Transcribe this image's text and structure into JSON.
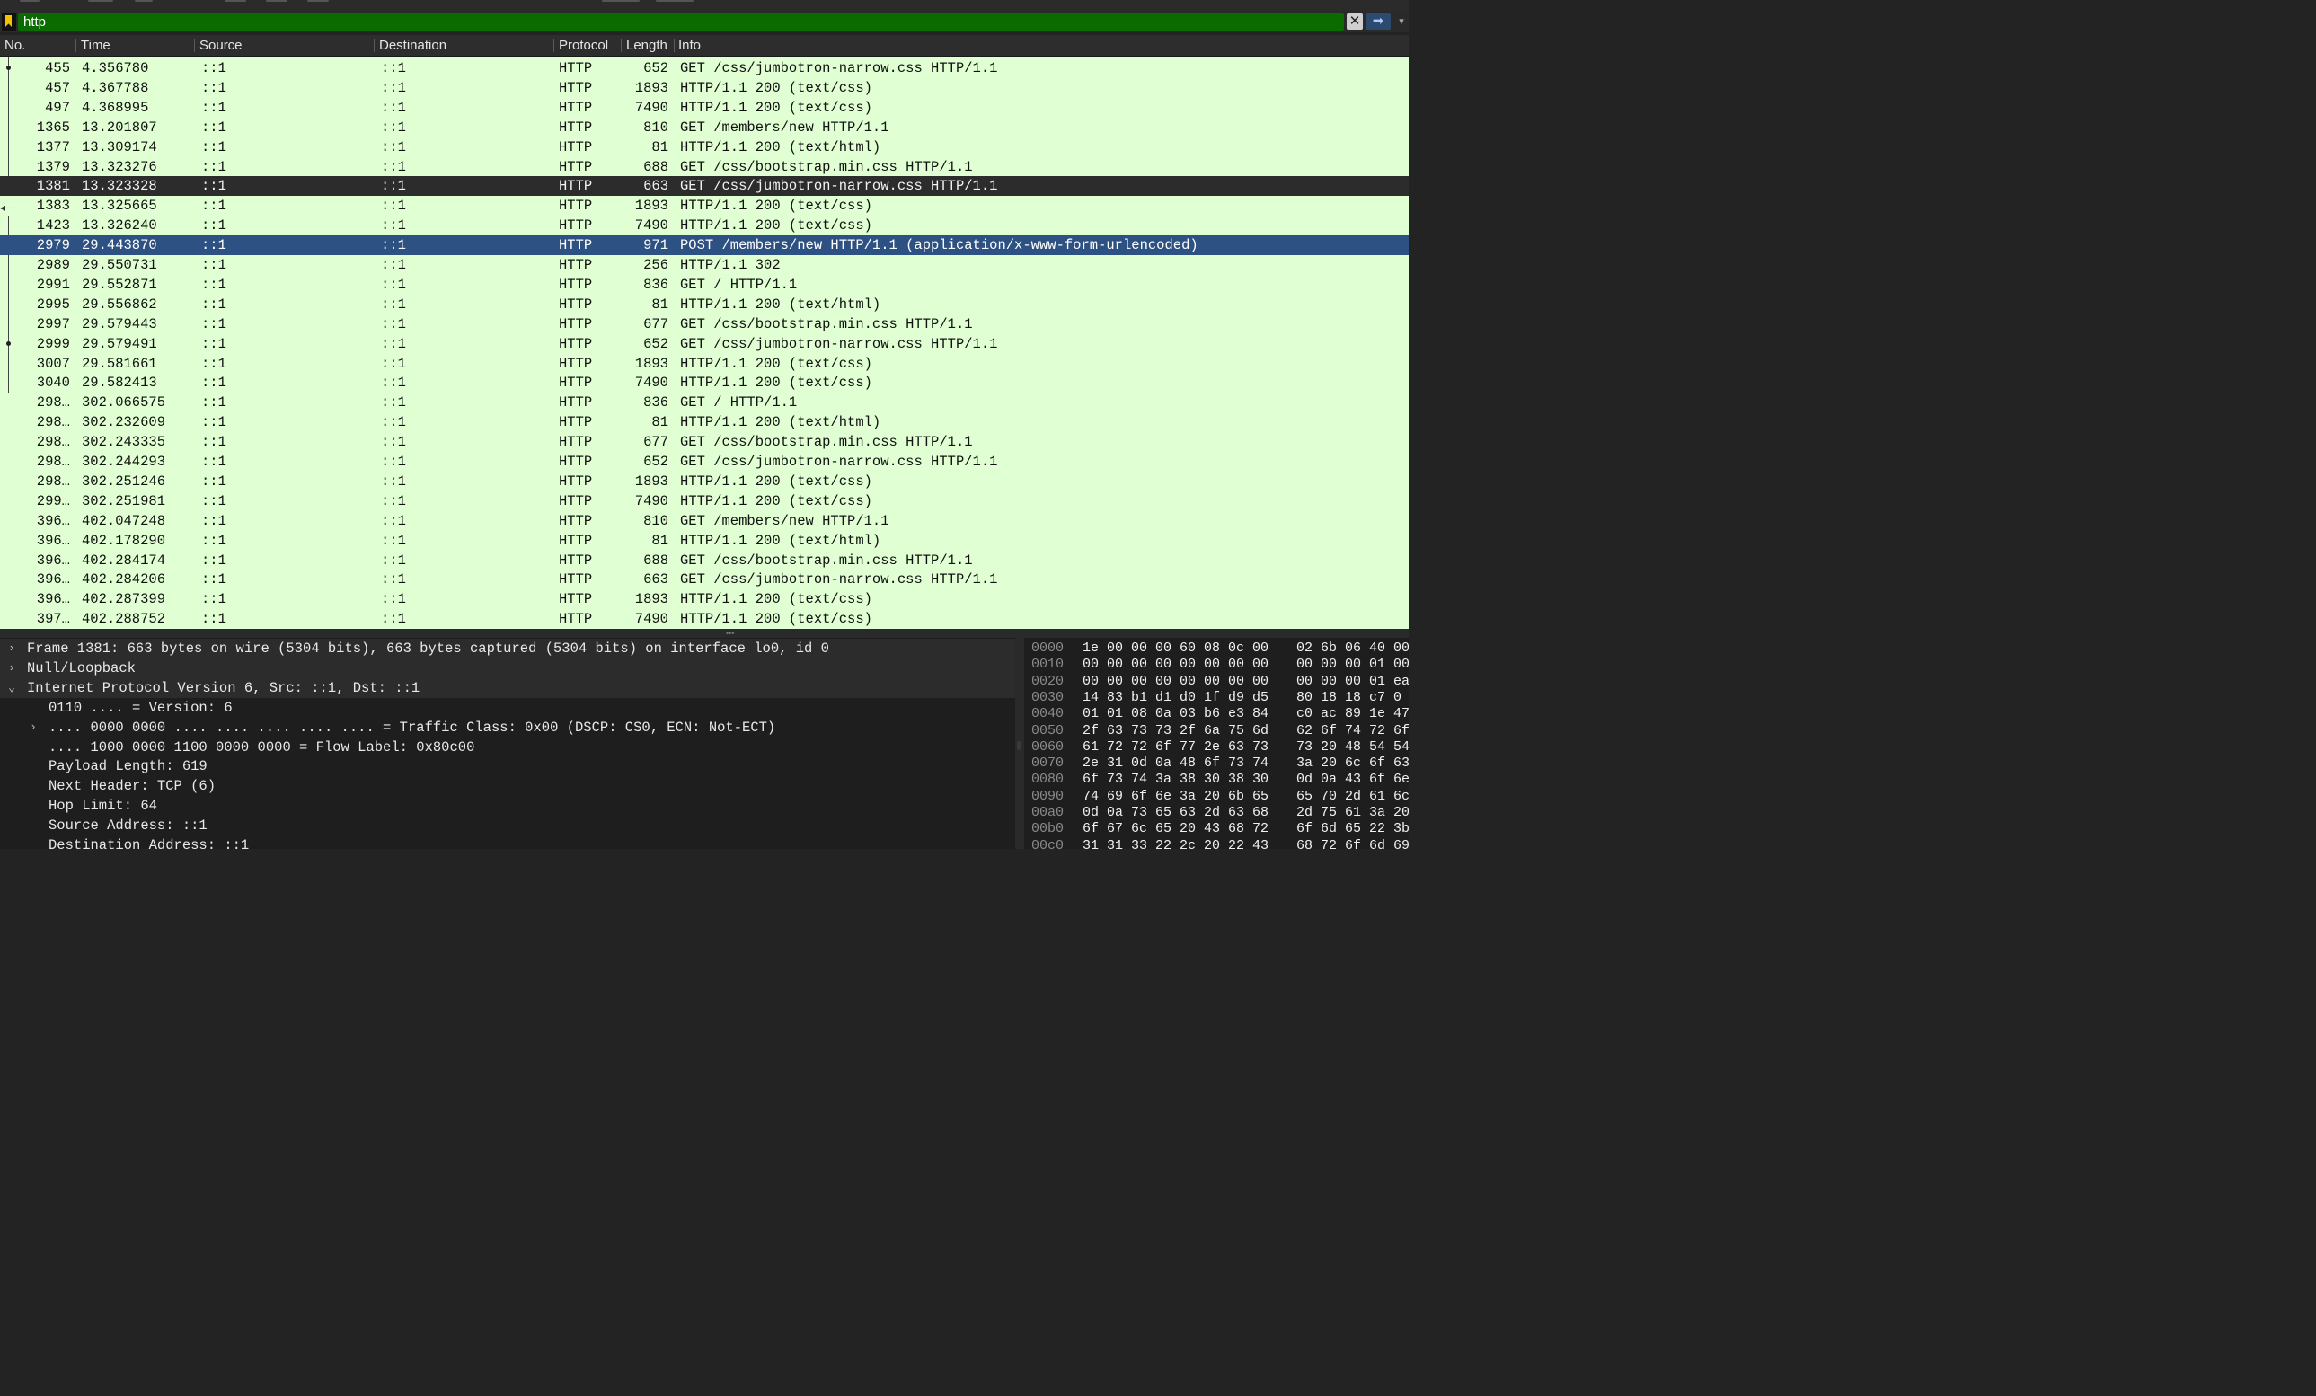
{
  "filter": {
    "value": "http",
    "clear_symbol": "✕",
    "apply_symbol": "➡",
    "dropdown_symbol": "▾"
  },
  "columns": [
    "No.",
    "Time",
    "Source",
    "Destination",
    "Protocol",
    "Length",
    "Info"
  ],
  "packets": [
    {
      "no": "455",
      "time": "4.356780",
      "src": "::1",
      "dst": "::1",
      "proto": "HTTP",
      "len": "652",
      "info": "GET /css/jumbotron-narrow.css HTTP/1.1"
    },
    {
      "no": "457",
      "time": "4.367788",
      "src": "::1",
      "dst": "::1",
      "proto": "HTTP",
      "len": "1893",
      "info": "HTTP/1.1 200   (text/css)"
    },
    {
      "no": "497",
      "time": "4.368995",
      "src": "::1",
      "dst": "::1",
      "proto": "HTTP",
      "len": "7490",
      "info": "HTTP/1.1 200   (text/css)"
    },
    {
      "no": "1365",
      "time": "13.201807",
      "src": "::1",
      "dst": "::1",
      "proto": "HTTP",
      "len": "810",
      "info": "GET /members/new HTTP/1.1"
    },
    {
      "no": "1377",
      "time": "13.309174",
      "src": "::1",
      "dst": "::1",
      "proto": "HTTP",
      "len": "81",
      "info": "HTTP/1.1 200   (text/html)"
    },
    {
      "no": "1379",
      "time": "13.323276",
      "src": "::1",
      "dst": "::1",
      "proto": "HTTP",
      "len": "688",
      "info": "GET /css/bootstrap.min.css HTTP/1.1"
    },
    {
      "no": "1381",
      "time": "13.323328",
      "src": "::1",
      "dst": "::1",
      "proto": "HTTP",
      "len": "663",
      "info": "GET /css/jumbotron-narrow.css HTTP/1.1"
    },
    {
      "no": "1383",
      "time": "13.325665",
      "src": "::1",
      "dst": "::1",
      "proto": "HTTP",
      "len": "1893",
      "info": "HTTP/1.1 200   (text/css)"
    },
    {
      "no": "1423",
      "time": "13.326240",
      "src": "::1",
      "dst": "::1",
      "proto": "HTTP",
      "len": "7490",
      "info": "HTTP/1.1 200   (text/css)"
    },
    {
      "no": "2979",
      "time": "29.443870",
      "src": "::1",
      "dst": "::1",
      "proto": "HTTP",
      "len": "971",
      "info": "POST /members/new HTTP/1.1  (application/x-www-form-urlencoded)"
    },
    {
      "no": "2989",
      "time": "29.550731",
      "src": "::1",
      "dst": "::1",
      "proto": "HTTP",
      "len": "256",
      "info": "HTTP/1.1 302"
    },
    {
      "no": "2991",
      "time": "29.552871",
      "src": "::1",
      "dst": "::1",
      "proto": "HTTP",
      "len": "836",
      "info": "GET / HTTP/1.1"
    },
    {
      "no": "2995",
      "time": "29.556862",
      "src": "::1",
      "dst": "::1",
      "proto": "HTTP",
      "len": "81",
      "info": "HTTP/1.1 200   (text/html)"
    },
    {
      "no": "2997",
      "time": "29.579443",
      "src": "::1",
      "dst": "::1",
      "proto": "HTTP",
      "len": "677",
      "info": "GET /css/bootstrap.min.css HTTP/1.1"
    },
    {
      "no": "2999",
      "time": "29.579491",
      "src": "::1",
      "dst": "::1",
      "proto": "HTTP",
      "len": "652",
      "info": "GET /css/jumbotron-narrow.css HTTP/1.1"
    },
    {
      "no": "3007",
      "time": "29.581661",
      "src": "::1",
      "dst": "::1",
      "proto": "HTTP",
      "len": "1893",
      "info": "HTTP/1.1 200   (text/css)"
    },
    {
      "no": "3040",
      "time": "29.582413",
      "src": "::1",
      "dst": "::1",
      "proto": "HTTP",
      "len": "7490",
      "info": "HTTP/1.1 200   (text/css)"
    },
    {
      "no": "298…",
      "time": "302.066575",
      "src": "::1",
      "dst": "::1",
      "proto": "HTTP",
      "len": "836",
      "info": "GET / HTTP/1.1"
    },
    {
      "no": "298…",
      "time": "302.232609",
      "src": "::1",
      "dst": "::1",
      "proto": "HTTP",
      "len": "81",
      "info": "HTTP/1.1 200   (text/html)"
    },
    {
      "no": "298…",
      "time": "302.243335",
      "src": "::1",
      "dst": "::1",
      "proto": "HTTP",
      "len": "677",
      "info": "GET /css/bootstrap.min.css HTTP/1.1"
    },
    {
      "no": "298…",
      "time": "302.244293",
      "src": "::1",
      "dst": "::1",
      "proto": "HTTP",
      "len": "652",
      "info": "GET /css/jumbotron-narrow.css HTTP/1.1"
    },
    {
      "no": "298…",
      "time": "302.251246",
      "src": "::1",
      "dst": "::1",
      "proto": "HTTP",
      "len": "1893",
      "info": "HTTP/1.1 200   (text/css)"
    },
    {
      "no": "299…",
      "time": "302.251981",
      "src": "::1",
      "dst": "::1",
      "proto": "HTTP",
      "len": "7490",
      "info": "HTTP/1.1 200   (text/css)"
    },
    {
      "no": "396…",
      "time": "402.047248",
      "src": "::1",
      "dst": "::1",
      "proto": "HTTP",
      "len": "810",
      "info": "GET /members/new HTTP/1.1"
    },
    {
      "no": "396…",
      "time": "402.178290",
      "src": "::1",
      "dst": "::1",
      "proto": "HTTP",
      "len": "81",
      "info": "HTTP/1.1 200   (text/html)"
    },
    {
      "no": "396…",
      "time": "402.284174",
      "src": "::1",
      "dst": "::1",
      "proto": "HTTP",
      "len": "688",
      "info": "GET /css/bootstrap.min.css HTTP/1.1"
    },
    {
      "no": "396…",
      "time": "402.284206",
      "src": "::1",
      "dst": "::1",
      "proto": "HTTP",
      "len": "663",
      "info": "GET /css/jumbotron-narrow.css HTTP/1.1"
    },
    {
      "no": "396…",
      "time": "402.287399",
      "src": "::1",
      "dst": "::1",
      "proto": "HTTP",
      "len": "1893",
      "info": "HTTP/1.1 200   (text/css)"
    },
    {
      "no": "397…",
      "time": "402.288752",
      "src": "::1",
      "dst": "::1",
      "proto": "HTTP",
      "len": "7490",
      "info": "HTTP/1.1 200   (text/css)"
    }
  ],
  "selected_index": 6,
  "marked_index": 9,
  "details": [
    {
      "text": "Frame 1381: 663 bytes on wire (5304 bits), 663 bytes captured (5304 bits) on interface lo0, id 0",
      "toggle": "›",
      "level": 0,
      "top": true
    },
    {
      "text": "Null/Loopback",
      "toggle": "›",
      "level": 0,
      "top": true
    },
    {
      "text": "Internet Protocol Version 6, Src: ::1, Dst: ::1",
      "toggle": "⌄",
      "level": 0,
      "top": true
    },
    {
      "text": "0110 .... = Version: 6",
      "toggle": "",
      "level": 1
    },
    {
      "text": ".... 0000 0000 .... .... .... .... .... = Traffic Class: 0x00 (DSCP: CS0, ECN: Not-ECT)",
      "toggle": "›",
      "level": 1
    },
    {
      "text": ".... 1000 0000 1100 0000 0000 = Flow Label: 0x80c00",
      "toggle": "",
      "level": 1
    },
    {
      "text": "Payload Length: 619",
      "toggle": "",
      "level": 1
    },
    {
      "text": "Next Header: TCP (6)",
      "toggle": "",
      "level": 1
    },
    {
      "text": "Hop Limit: 64",
      "toggle": "",
      "level": 1
    },
    {
      "text": "Source Address: ::1",
      "toggle": "",
      "level": 1
    },
    {
      "text": "Destination Address: ::1",
      "toggle": "",
      "level": 1
    }
  ],
  "hex": [
    {
      "off": "0000",
      "b1": "1e 00 00 00 60 08 0c 00",
      "b2": "02 6b 06 40 00"
    },
    {
      "off": "0010",
      "b1": "00 00 00 00 00 00 00 00",
      "b2": "00 00 00 01 00"
    },
    {
      "off": "0020",
      "b1": "00 00 00 00 00 00 00 00",
      "b2": "00 00 00 01 ea"
    },
    {
      "off": "0030",
      "b1": "14 83 b1 d1 d0 1f d9 d5",
      "b2": "80 18 18 c7 0"
    },
    {
      "off": "0040",
      "b1": "01 01 08 0a 03 b6 e3 84",
      "b2": "c0 ac 89 1e 47"
    },
    {
      "off": "0050",
      "b1": "2f 63 73 73 2f 6a 75 6d",
      "b2": "62 6f 74 72 6f"
    },
    {
      "off": "0060",
      "b1": "61 72 72 6f 77 2e 63 73",
      "b2": "73 20 48 54 54"
    },
    {
      "off": "0070",
      "b1": "2e 31 0d 0a 48 6f 73 74",
      "b2": "3a 20 6c 6f 63"
    },
    {
      "off": "0080",
      "b1": "6f 73 74 3a 38 30 38 30",
      "b2": "0d 0a 43 6f 6e"
    },
    {
      "off": "0090",
      "b1": "74 69 6f 6e 3a 20 6b 65",
      "b2": "65 70 2d 61 6c"
    },
    {
      "off": "00a0",
      "b1": "0d 0a 73 65 63 2d 63 68",
      "b2": "2d 75 61 3a 20"
    },
    {
      "off": "00b0",
      "b1": "6f 67 6c 65 20 43 68 72",
      "b2": "6f 6d 65 22 3b"
    },
    {
      "off": "00c0",
      "b1": "31 31 33 22 2c 20 22 43",
      "b2": "68 72 6f 6d 69"
    }
  ]
}
